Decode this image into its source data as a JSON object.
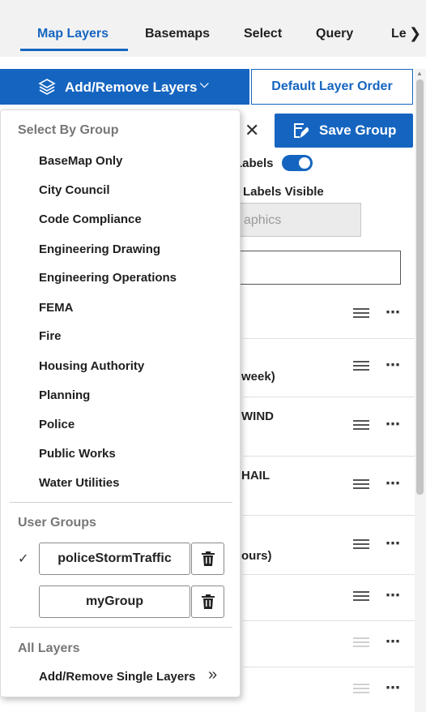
{
  "tabs": [
    {
      "label": "Map Layers",
      "active": true
    },
    {
      "label": "Basemaps"
    },
    {
      "label": "Select"
    },
    {
      "label": "Query"
    },
    {
      "label": "Le"
    }
  ],
  "toolbar": {
    "add_remove_label": "Add/Remove Layers",
    "default_order_label": "Default Layer Order",
    "save_group_label": "Save Group"
  },
  "panel": {
    "labels_toggle_text": "Labels",
    "labels_visible_text": "Labels Visible",
    "graphics_placeholder": "aphics",
    "rows": [
      {
        "text": ""
      },
      {
        "text": "week)"
      },
      {
        "text": "WIND"
      },
      {
        "text": "HAIL"
      },
      {
        "text": "ours)"
      },
      {
        "text": ""
      },
      {
        "text": ""
      },
      {
        "text": ""
      }
    ]
  },
  "dropdown": {
    "select_by_group_header": "Select By Group",
    "groups": [
      "BaseMap Only",
      "City Council",
      "Code Compliance",
      "Engineering Drawing",
      "Engineering Operations",
      "FEMA",
      "Fire",
      "Housing Authority",
      "Planning",
      "Police",
      "Public Works",
      "Water Utilities"
    ],
    "user_groups_header": "User Groups",
    "user_groups": [
      {
        "name": "policeStormTraffic",
        "selected": true
      },
      {
        "name": "myGroup",
        "selected": false
      }
    ],
    "all_layers_header": "All Layers",
    "single_layers_label": "Add/Remove Single Layers"
  },
  "colors": {
    "accent": "#1565c0"
  }
}
